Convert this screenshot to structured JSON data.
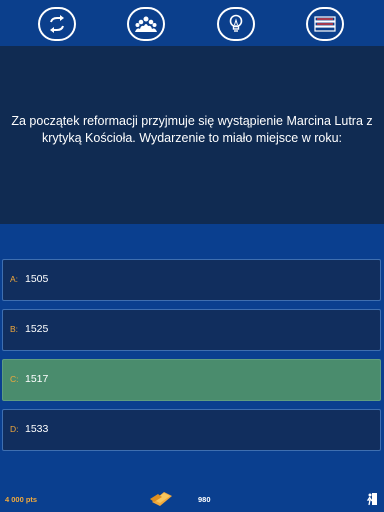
{
  "toolbar": {
    "icons": [
      "swap-icon",
      "audience-icon",
      "lightbulb-icon",
      "list-icon"
    ]
  },
  "question": {
    "text": "Za początek reformacji przyjmuje się wystąpienie Marcina Lutra z krytyką Kościoła. Wydarzenie to miało miejsce w roku:"
  },
  "answers": [
    {
      "letter": "A:",
      "value": "1505",
      "selected": false
    },
    {
      "letter": "B:",
      "value": "1525",
      "selected": false
    },
    {
      "letter": "C:",
      "value": "1517",
      "selected": true
    },
    {
      "letter": "D:",
      "value": "1533",
      "selected": false
    }
  ],
  "status": {
    "points": "4 000 pts",
    "coins": "980"
  },
  "colors": {
    "background": "#0a3f8f",
    "question_panel": "#102b52",
    "answer_bg": "#112e5e",
    "answer_selected": "#4a8c6d",
    "accent": "#f2a93b"
  }
}
